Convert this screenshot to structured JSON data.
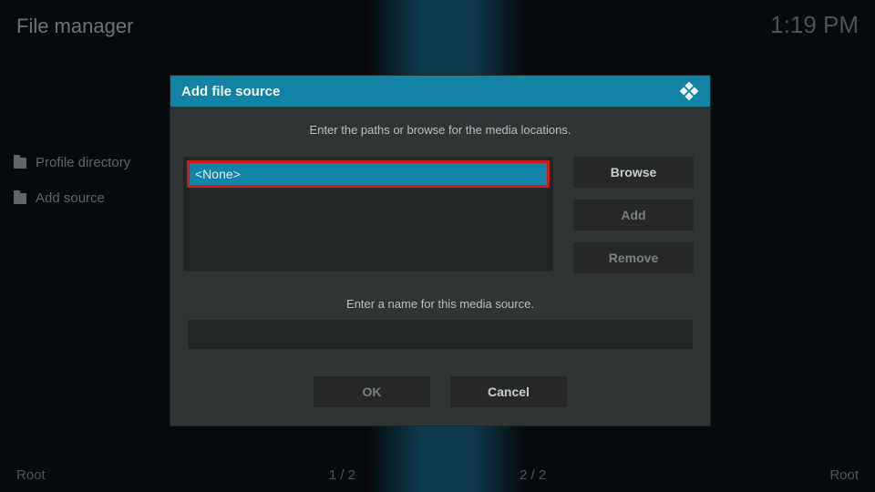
{
  "header": {
    "title": "File manager",
    "clock": "1:19 PM"
  },
  "sidebar": {
    "items": [
      {
        "label": "Profile directory"
      },
      {
        "label": "Add source"
      }
    ]
  },
  "dialog": {
    "title": "Add file source",
    "hint": "Enter the paths or browse for the media locations.",
    "path_value": "<None>",
    "browse": "Browse",
    "add": "Add",
    "remove": "Remove",
    "name_hint": "Enter a name for this media source.",
    "name_value": "",
    "ok": "OK",
    "cancel": "Cancel"
  },
  "status": {
    "left": "Root",
    "page1": "1 / 2",
    "page2": "2 / 2",
    "right": "Root"
  }
}
